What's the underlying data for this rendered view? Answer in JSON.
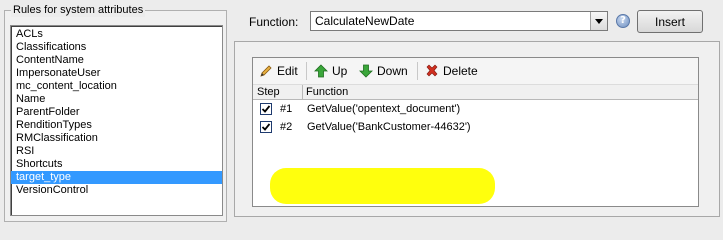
{
  "rules_group": {
    "title": "Rules for system attributes",
    "attributes": [
      "ACLs",
      "Classifications",
      "ContentName",
      "ImpersonateUser",
      "mc_content_location",
      "Name",
      "ParentFolder",
      "RenditionTypes",
      "RMClassification",
      "RSI",
      "Shortcuts",
      "target_type",
      "VersionControl"
    ],
    "selected": "target_type"
  },
  "function_row": {
    "label": "Function:",
    "selected_function": "CalculateNewDate",
    "help_icon": "help-icon",
    "insert_label": "Insert"
  },
  "toolbar": {
    "edit_label": "Edit",
    "up_label": "Up",
    "down_label": "Down",
    "delete_label": "Delete"
  },
  "grid": {
    "headers": {
      "step": "Step",
      "function": "Function"
    },
    "rows": [
      {
        "checked": true,
        "step": "#1",
        "function": "GetValue('opentext_document')"
      },
      {
        "checked": true,
        "step": "#2",
        "function": "GetValue('BankCustomer-44632')"
      }
    ]
  },
  "colors": {
    "selection": "#3399ff",
    "highlight": "#ffff00",
    "up_arrow": "#3aa63a",
    "down_arrow": "#3aa63a",
    "delete_x": "#d03020"
  }
}
